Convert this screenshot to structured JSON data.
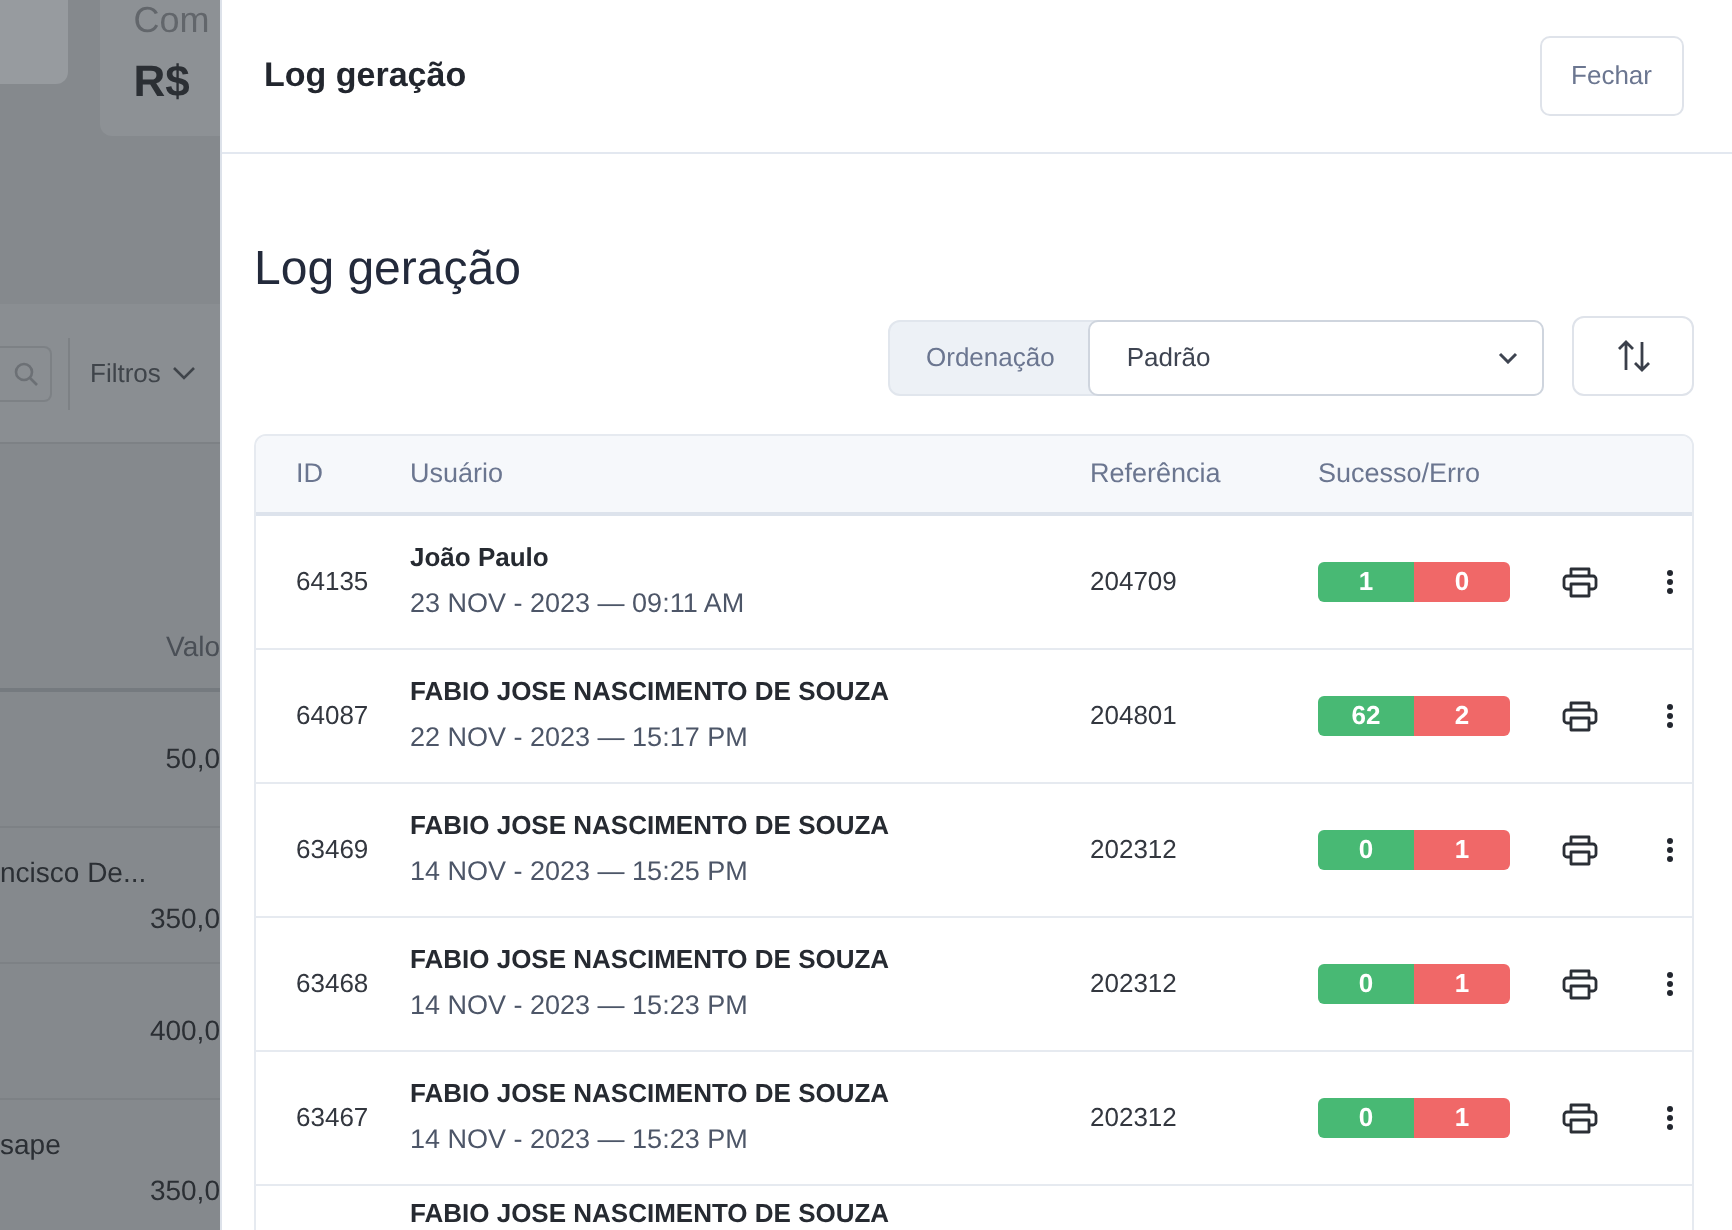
{
  "background_page": {
    "card_label": "Com",
    "card_value": "R$",
    "filter_button": "Filtros",
    "table_header": "Valo",
    "rows": [
      {
        "value": "50,0"
      },
      {
        "name": "ncisco De...",
        "value": "350,0"
      },
      {
        "value": "400,0"
      },
      {
        "name": "sape",
        "value": "350,0"
      }
    ]
  },
  "offcanvas": {
    "title": "Log geração",
    "close_button": "Fechar"
  },
  "heading": "Log geração",
  "sort": {
    "label": "Ordenação",
    "value": "Padrão"
  },
  "table": {
    "columns": [
      "ID",
      "Usuário",
      "Referência",
      "Sucesso/Erro"
    ],
    "rows": [
      {
        "id": "64135",
        "user": "João Paulo",
        "datetime": "23 NOV - 2023 — 09:11 AM",
        "reference": "204709",
        "success": "1",
        "error": "0"
      },
      {
        "id": "64087",
        "user": "FABIO JOSE NASCIMENTO DE SOUZA",
        "datetime": "22 NOV - 2023 — 15:17 PM",
        "reference": "204801",
        "success": "62",
        "error": "2"
      },
      {
        "id": "63469",
        "user": "FABIO JOSE NASCIMENTO DE SOUZA",
        "datetime": "14 NOV - 2023 — 15:25 PM",
        "reference": "202312",
        "success": "0",
        "error": "1"
      },
      {
        "id": "63468",
        "user": "FABIO JOSE NASCIMENTO DE SOUZA",
        "datetime": "14 NOV - 2023 — 15:23 PM",
        "reference": "202312",
        "success": "0",
        "error": "1"
      },
      {
        "id": "63467",
        "user": "FABIO JOSE NASCIMENTO DE SOUZA",
        "datetime": "14 NOV - 2023 — 15:23 PM",
        "reference": "202312",
        "success": "0",
        "error": "1"
      },
      {
        "user": "FABIO JOSE NASCIMENTO DE SOUZA"
      }
    ]
  }
}
